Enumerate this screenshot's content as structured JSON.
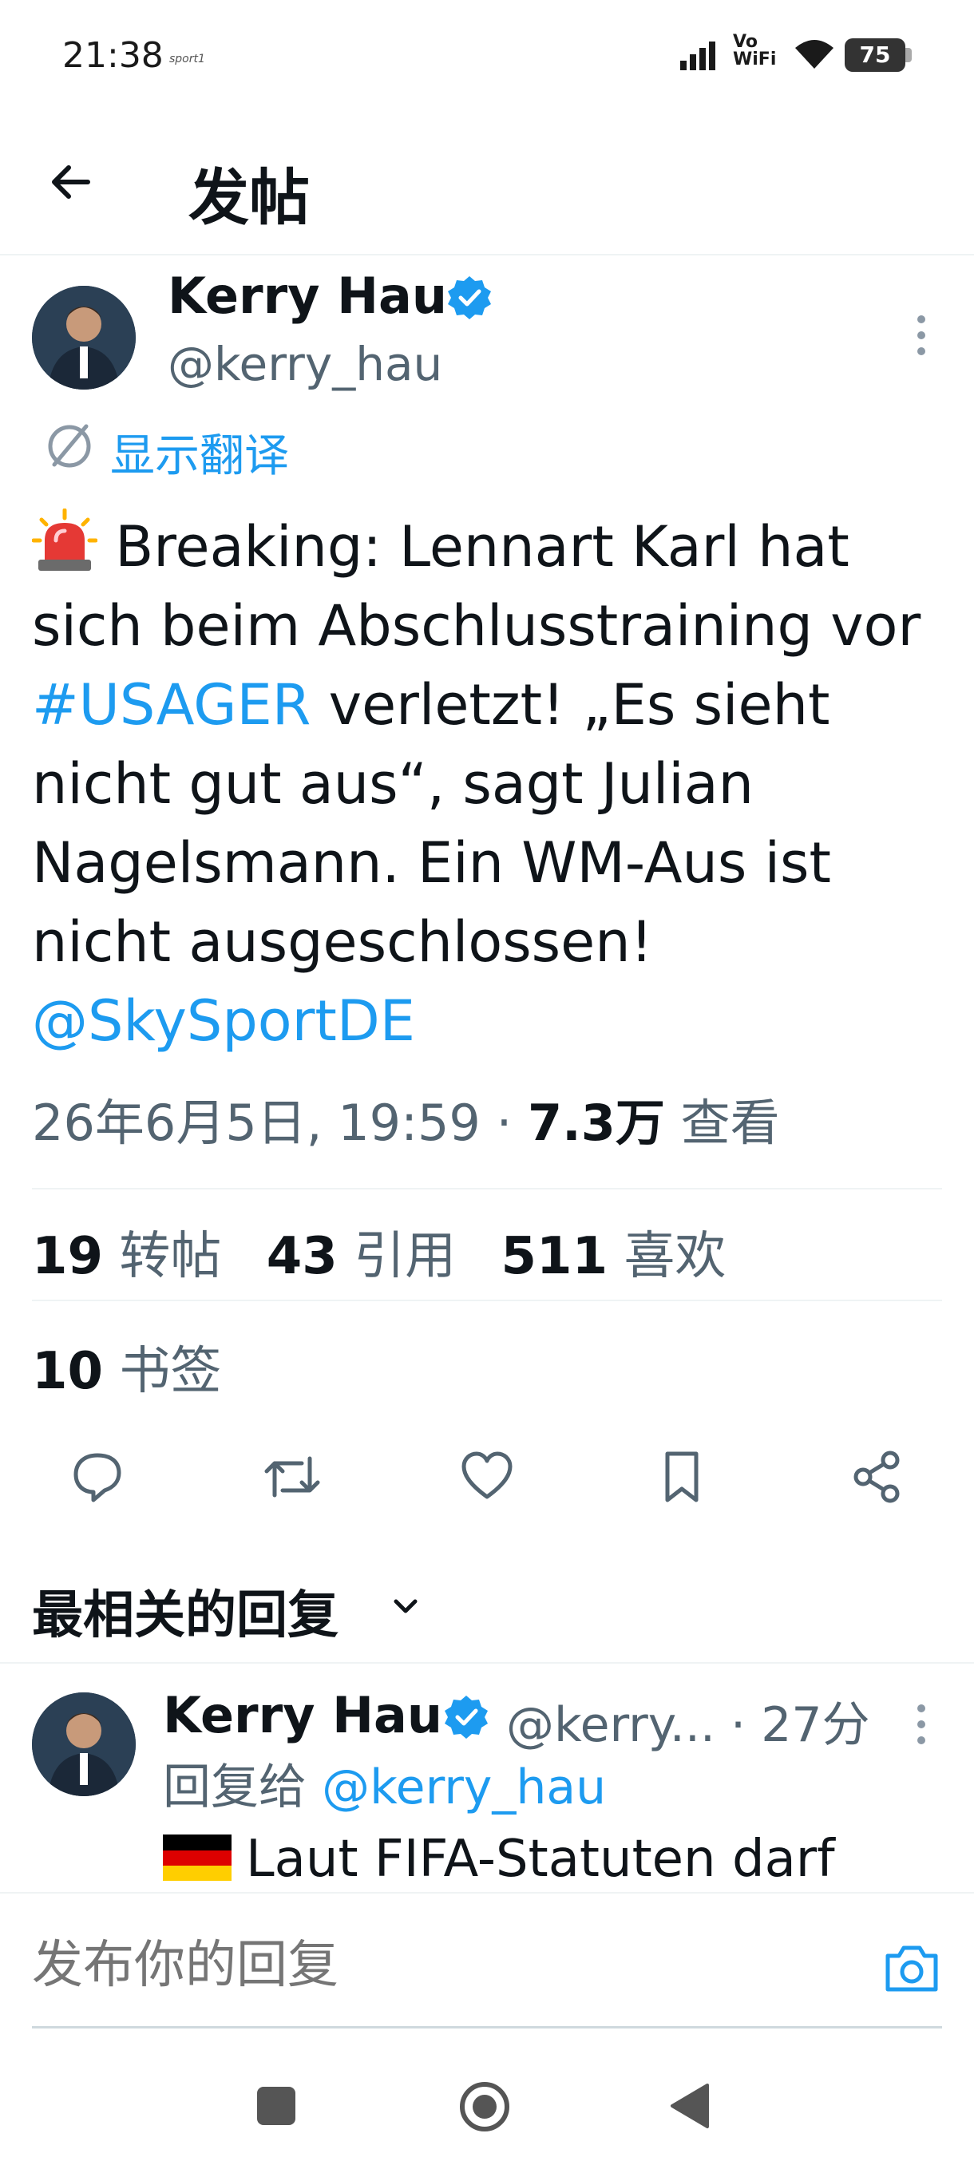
{
  "status_bar": {
    "time": "21:38",
    "app_label": "sport1",
    "network": "Vo WiFi",
    "battery": "75"
  },
  "header": {
    "title": "发帖"
  },
  "tweet": {
    "author_name": "Kerry Hau",
    "author_handle": "@kerry_hau",
    "translate_label": "显示翻译",
    "body": {
      "part1": " Breaking: Lennart Karl hat sich beim Abschlusstraining vor ",
      "hashtag": "#USAGER",
      "part2": " verletzt!  „Es sieht nicht gut aus“, sagt Julian Nagelsmann. Ein WM-Aus ist nicht ausgeschlossen!",
      "mention": "@SkySportDE"
    },
    "timestamp": "26年6月5日, 19:59",
    "separator": " · ",
    "views": "7.3万",
    "views_label": " 查看"
  },
  "stats": {
    "retweets": "19",
    "retweets_label": "转帖",
    "quotes": "43",
    "quotes_label": "引用",
    "likes": "511",
    "likes_label": "喜欢",
    "bookmarks": "10",
    "bookmarks_label": "书签"
  },
  "replies_section": {
    "sort_label": "最相关的回复"
  },
  "reply": {
    "author_name": "Kerry Hau",
    "author_handle": "@kerry...",
    "time": " · 27分",
    "reply_to_label": "回复给 ",
    "reply_to_handle": "@kerry_hau",
    "text": "Laut FIFA-Statuten darf"
  },
  "compose": {
    "placeholder": "发布你的回复"
  },
  "colors": {
    "accent": "#1d9bf0",
    "text_primary": "#0f1419",
    "text_secondary": "#536471"
  }
}
